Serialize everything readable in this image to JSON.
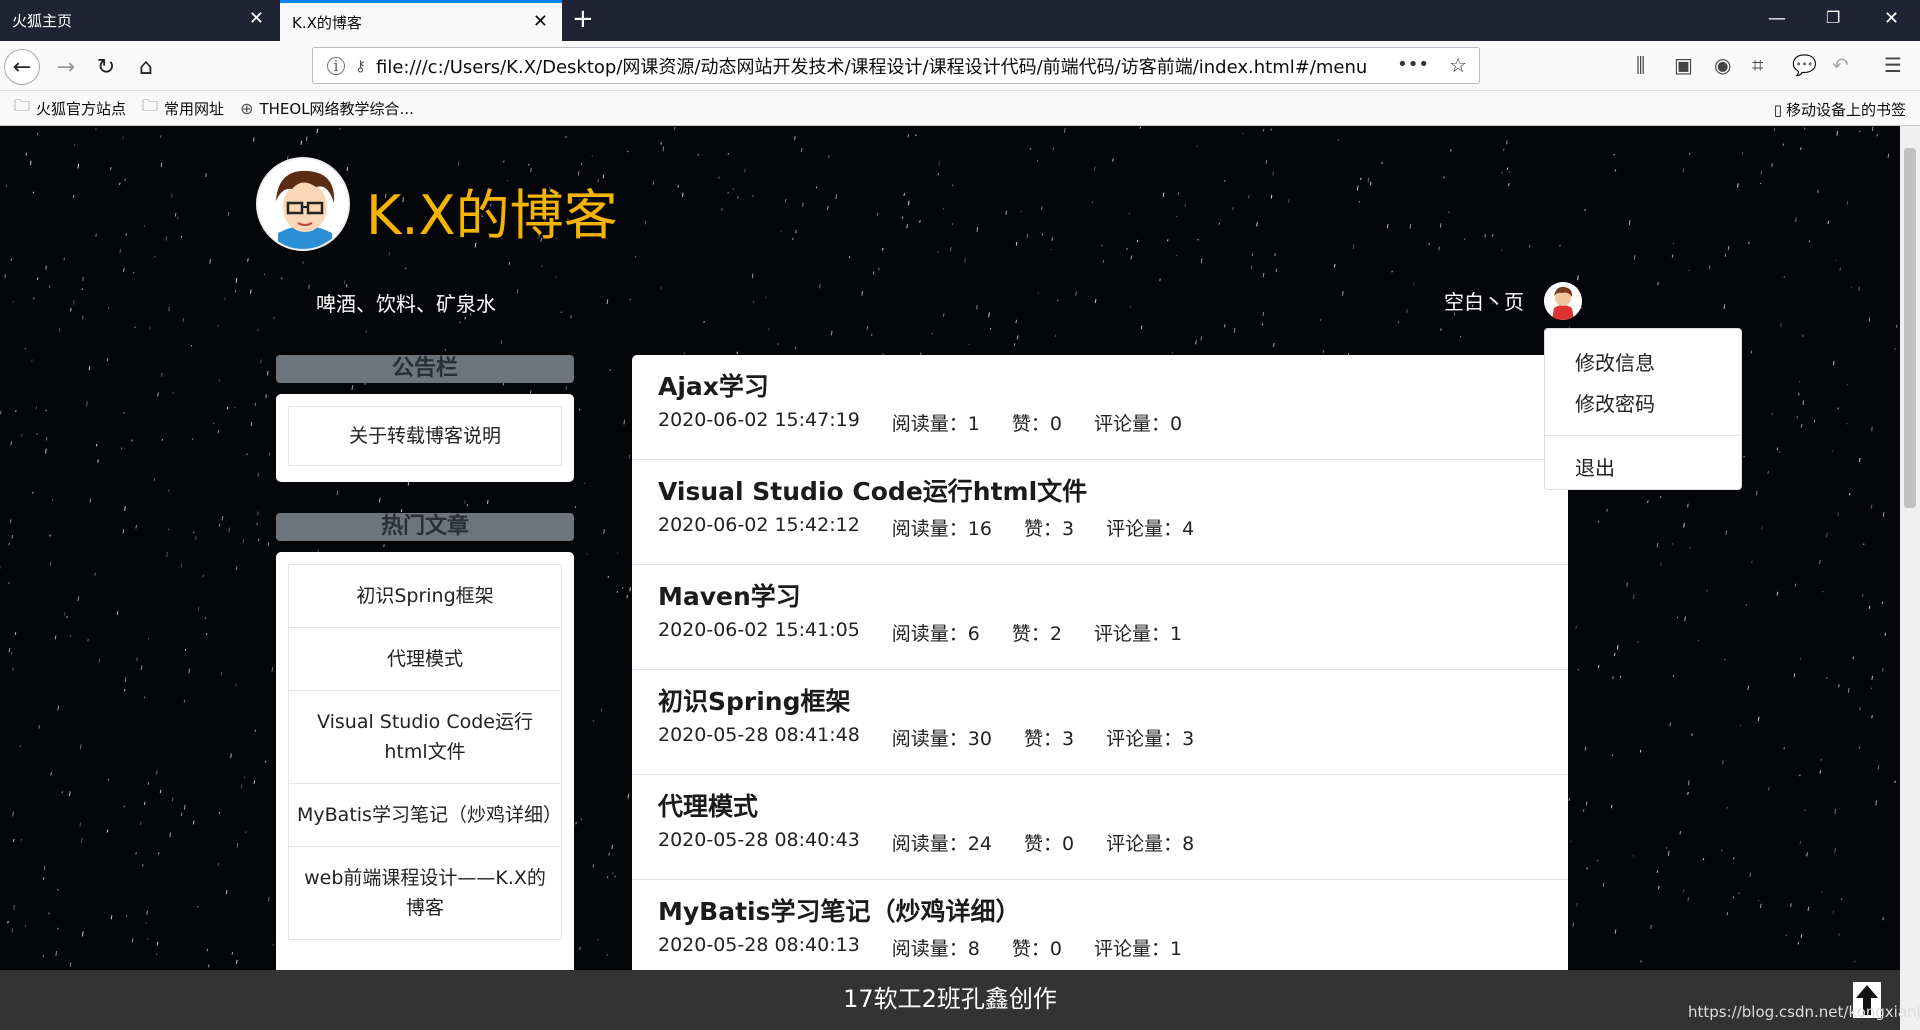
{
  "browser": {
    "tabs": [
      {
        "label": "火狐主页",
        "active": false
      },
      {
        "label": "K.X的博客",
        "active": true
      }
    ],
    "url": "file:///c:/Users/K.X/Desktop/网课资源/动态网站开发技术/课程设计/课程设计代码/前端代码/访客前端/index.html#/menu",
    "bookmarks": [
      "火狐官方站点",
      "常用网址",
      "THEOL网络教学综合..."
    ],
    "mobile_bookmarks": "移动设备上的书签"
  },
  "header": {
    "title": "K.X的博客",
    "slogan": "啤酒、饮料、矿泉水",
    "username": "空白丶页"
  },
  "dropdown": {
    "items": [
      "修改信息",
      "修改密码"
    ],
    "logout": "退出"
  },
  "notice": {
    "heading": "公告栏",
    "items": [
      "关于转载博客说明"
    ]
  },
  "hot": {
    "heading": "热门文章",
    "items": [
      "初识Spring框架",
      "代理模式",
      "Visual Studio Code运行html文件",
      "MyBatis学习笔记（炒鸡详细）",
      "web前端课程设计——K.X的博客"
    ]
  },
  "articles": [
    {
      "title": "Ajax学习",
      "date": "2020-06-02 15:47:19",
      "reads": "阅读量：1",
      "likes": "赞：0",
      "comments": "评论量：0"
    },
    {
      "title": "Visual Studio Code运行html文件",
      "date": "2020-06-02 15:42:12",
      "reads": "阅读量：16",
      "likes": "赞：3",
      "comments": "评论量：4"
    },
    {
      "title": "Maven学习",
      "date": "2020-06-02 15:41:05",
      "reads": "阅读量：6",
      "likes": "赞：2",
      "comments": "评论量：1"
    },
    {
      "title": "初识Spring框架",
      "date": "2020-05-28 08:41:48",
      "reads": "阅读量：30",
      "likes": "赞：3",
      "comments": "评论量：3"
    },
    {
      "title": "代理模式",
      "date": "2020-05-28 08:40:43",
      "reads": "阅读量：24",
      "likes": "赞：0",
      "comments": "评论量：8"
    },
    {
      "title": "MyBatis学习笔记（炒鸡详细）",
      "date": "2020-05-28 08:40:13",
      "reads": "阅读量：8",
      "likes": "赞：0",
      "comments": "评论量：1"
    }
  ],
  "footer": {
    "text": "17软工2班孔鑫创作"
  },
  "watermark": "https://blog.csdn.net/kongxianjin",
  "colors": {
    "title": "#f5b400",
    "page_bg": "#05060a",
    "footer_bg": "#333333",
    "section_bg": "#6c757d",
    "tab_active_accent": "#0a84ff"
  }
}
